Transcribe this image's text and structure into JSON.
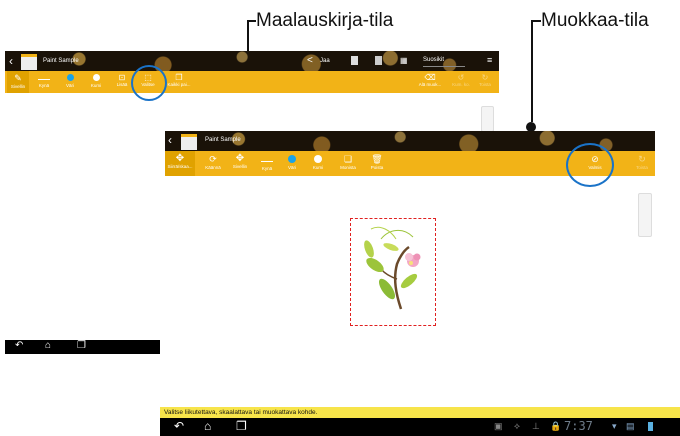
{
  "callouts": {
    "paint_book_mode": "Maalauskirja-tila",
    "edit_mode": "Muokkaa-tila"
  },
  "top_screen": {
    "title": "Paint Sample",
    "header": {
      "share_label": "Jaa",
      "favorites_label": "Suosikit"
    },
    "toolbar": [
      {
        "label": "Sivellin",
        "icon": "brush-icon"
      },
      {
        "label": "Kynä",
        "icon": "pen-icon"
      },
      {
        "label": "Väri",
        "icon": "color-dot-icon"
      },
      {
        "label": "Kumi",
        "icon": "eraser-icon"
      },
      {
        "label": "Lisää",
        "icon": "insert-icon"
      },
      {
        "label": "Valitse",
        "icon": "select-icon"
      },
      {
        "label": "Kaikki pai...",
        "icon": "pages-icon"
      }
    ],
    "toolbar_right": [
      {
        "label": "Alä muok...",
        "icon": "eraser-all-icon"
      },
      {
        "label": "Kum. ko.",
        "icon": "undo-icon"
      },
      {
        "label": "Toista",
        "icon": "redo-icon"
      }
    ]
  },
  "bottom_screen": {
    "title": "Paint Sample",
    "toolbar": [
      {
        "label": "Siirrä/skaa...",
        "icon": "move-icon"
      },
      {
        "label": "Käännä",
        "icon": "rotate-icon"
      },
      {
        "label": "Sivellin",
        "icon": "brush-icon"
      },
      {
        "label": "Kynä",
        "icon": "pen-icon"
      },
      {
        "label": "Väri",
        "icon": "color-dot-icon"
      },
      {
        "label": "Kumi",
        "icon": "eraser-icon"
      },
      {
        "label": "Monista",
        "icon": "duplicate-icon"
      },
      {
        "label": "Poista",
        "icon": "trash-icon"
      }
    ],
    "toolbar_right": [
      {
        "label": "Valmis",
        "icon": "done-icon"
      },
      {
        "label": "Toista",
        "icon": "redo-icon"
      }
    ],
    "status_message": "Valitse liikutettava, skaalattava tai muokattava kohde.",
    "clock": "7:37"
  },
  "colors": {
    "toolbar": "#f2b317",
    "highlight_ring": "#1a73c8",
    "selection_dash": "#e02020",
    "status_bar": "#f7e44a"
  }
}
